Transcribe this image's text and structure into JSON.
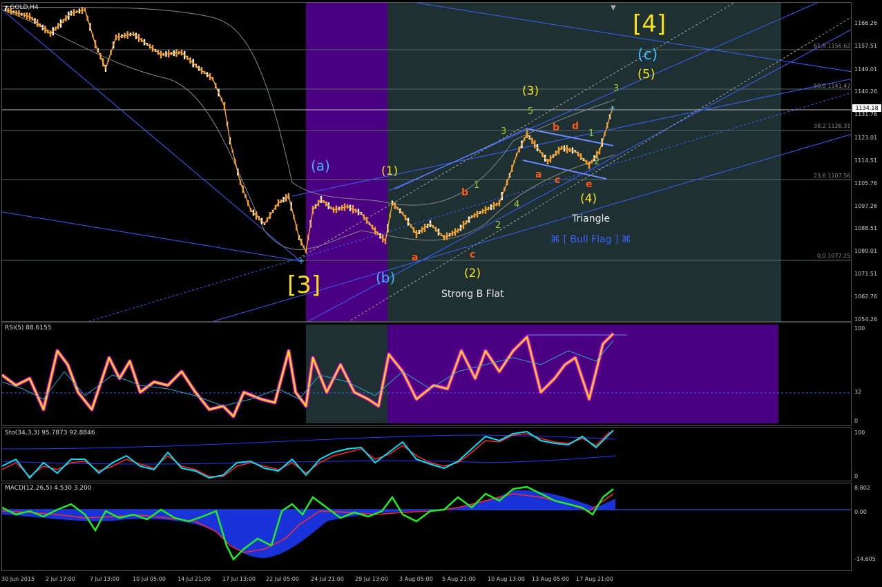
{
  "symbol_label": "GOLD,H4",
  "colors": {
    "purple_zone": "#4b0082",
    "dark_zone": "#1e3031",
    "candle": "#f0a030",
    "trend": "#3a63ff",
    "rsi_line": "#ffe000",
    "rsi_glow": "#ff00ff",
    "stoch_main": "#00e5ff",
    "stoch_signal": "#ff2a2a",
    "macd_line": "#22ee22",
    "macd_hist": "#1e3cff"
  },
  "price_axis": [
    "1166.26",
    "1157.51",
    "1149.01",
    "1140.26",
    "1131.76",
    "1123.01",
    "1114.51",
    "1105.76",
    "1097.26",
    "1088.51",
    "1080.01",
    "1071.51",
    "1062.76",
    "1054.26"
  ],
  "current_price": "1134.18",
  "fib_levels": [
    {
      "label": "61.8 1156.62"
    },
    {
      "label": "50.0 1141.47"
    },
    {
      "label": "38.2 1126.31"
    },
    {
      "label": "23.6 1107.56"
    },
    {
      "label": "0.0 1077.25"
    }
  ],
  "waves": {
    "w4_bracket": "[4]",
    "w3_bracket": "[3]",
    "a_paren": "(a)",
    "b_paren": "(b)",
    "c_paren": "(c)",
    "one": "(1)",
    "two": "(2)",
    "three": "(3)",
    "four": "(4)",
    "five": "(5)",
    "small_a1": "a",
    "small_c1": "c",
    "small_b1": "b",
    "small_a2": "a",
    "small_b2": "b",
    "small_c2": "c",
    "small_d2": "d",
    "small_e2": "e",
    "g1": "1",
    "g2": "2",
    "g3": "3",
    "g4": "4",
    "g5": "5",
    "g1b": "1",
    "g2b": "2",
    "g3b": "3",
    "strong_b_flat": "Strong B Flat",
    "triangle": "Triangle",
    "bull_flag": "⌘ [ Bull Flag ] ⌘"
  },
  "rsi": {
    "label": "RSI(5) 88.6155",
    "axis": [
      "100",
      "32",
      "0"
    ]
  },
  "stoch": {
    "label": "Sto(34,3,3) 95.7873 92.8846",
    "axis": [
      "100",
      "0"
    ]
  },
  "macd": {
    "label": "MACD(12,26,5) 4.530 3.200",
    "axis": [
      "8.802",
      "0.00",
      "-14.605"
    ]
  },
  "time_axis": [
    "30 Jun 2015",
    "2 Jul 17:00",
    "7 Jul 13:00",
    "10 Jul 05:00",
    "14 Jul 21:00",
    "17 Jul 13:00",
    "22 Jul 05:00",
    "24 Jul 21:00",
    "29 Jul 13:00",
    "3 Aug 05:00",
    "5 Aug 21:00",
    "10 Aug 13:00",
    "13 Aug 05:00",
    "17 Aug 21:00"
  ]
}
